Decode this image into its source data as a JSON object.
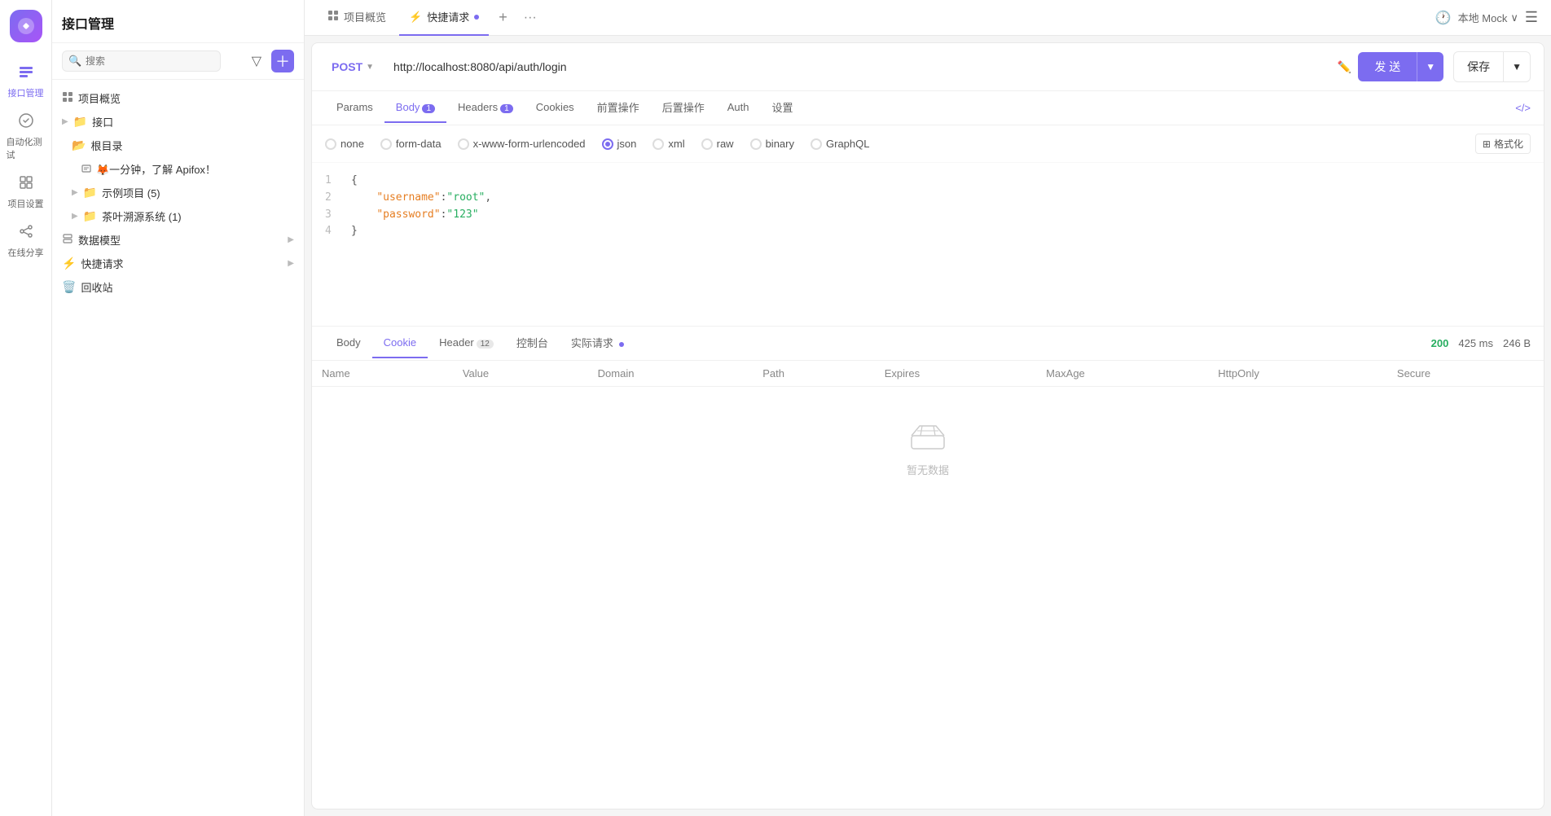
{
  "app": {
    "title": "接口管理"
  },
  "left_nav": {
    "items": [
      {
        "id": "api-mgmt",
        "label": "接口管理",
        "icon": "🔌",
        "active": true
      },
      {
        "id": "auto-test",
        "label": "自动化测试",
        "icon": "⚙️",
        "active": false
      },
      {
        "id": "project-settings",
        "label": "项目设置",
        "icon": "📋",
        "active": false
      },
      {
        "id": "online-share",
        "label": "在线分享",
        "icon": "🔗",
        "active": false
      }
    ]
  },
  "sidebar": {
    "title": "接口管理",
    "search_placeholder": "搜索",
    "tree": [
      {
        "id": "overview",
        "label": "项目概览",
        "icon": "📊",
        "indent": 0,
        "type": "item"
      },
      {
        "id": "api-group",
        "label": "接口",
        "icon": "📁",
        "indent": 0,
        "type": "group",
        "hasArrow": true
      },
      {
        "id": "root-dir",
        "label": "根目录",
        "icon": "📁",
        "indent": 1,
        "type": "folder"
      },
      {
        "id": "fox-intro",
        "label": "🦊一分钟，了解 Apifox！",
        "indent": 2,
        "type": "api"
      },
      {
        "id": "sample-proj",
        "label": "示例项目 (5)",
        "indent": 1,
        "type": "folder",
        "hasArrow": true
      },
      {
        "id": "tea-proj",
        "label": "茶叶溯源系统 (1)",
        "indent": 1,
        "type": "folder",
        "hasArrow": true
      },
      {
        "id": "data-model",
        "label": "数据模型",
        "icon": "📦",
        "indent": 0,
        "type": "group",
        "hasArrow": true
      },
      {
        "id": "quick-req",
        "label": "快捷请求",
        "icon": "⚡",
        "indent": 0,
        "type": "group",
        "hasArrow": true
      },
      {
        "id": "recycle",
        "label": "回收站",
        "icon": "🗑️",
        "indent": 0,
        "type": "item"
      }
    ]
  },
  "tabs": {
    "items": [
      {
        "id": "overview-tab",
        "label": "项目概览",
        "icon": "📊",
        "active": false
      },
      {
        "id": "quick-req-tab",
        "label": "快捷请求",
        "icon": "⚡",
        "active": true,
        "hasDot": true
      }
    ],
    "add_label": "+",
    "more_label": "···"
  },
  "top_right": {
    "mock_label": "本地 Mock",
    "clock_icon": "🕐"
  },
  "request": {
    "method": "POST",
    "url": "http://localhost:8080/api/auth/login",
    "send_label": "发 送",
    "save_label": "保存",
    "tabs": [
      {
        "id": "params",
        "label": "Params",
        "active": false
      },
      {
        "id": "body",
        "label": "Body",
        "active": true,
        "badge": "1"
      },
      {
        "id": "headers",
        "label": "Headers",
        "active": false,
        "badge": "1"
      },
      {
        "id": "cookies",
        "label": "Cookies",
        "active": false
      },
      {
        "id": "pre-script",
        "label": "前置操作",
        "active": false
      },
      {
        "id": "post-script",
        "label": "后置操作",
        "active": false
      },
      {
        "id": "auth",
        "label": "Auth",
        "active": false
      },
      {
        "id": "settings",
        "label": "设置",
        "active": false
      }
    ],
    "body_types": [
      {
        "id": "none",
        "label": "none",
        "checked": false
      },
      {
        "id": "form-data",
        "label": "form-data",
        "checked": false
      },
      {
        "id": "x-www-form-urlencoded",
        "label": "x-www-form-urlencoded",
        "checked": false
      },
      {
        "id": "json",
        "label": "json",
        "checked": true
      },
      {
        "id": "xml",
        "label": "xml",
        "checked": false
      },
      {
        "id": "raw",
        "label": "raw",
        "checked": false
      },
      {
        "id": "binary",
        "label": "binary",
        "checked": false
      },
      {
        "id": "graphql",
        "label": "GraphQL",
        "checked": false
      }
    ],
    "format_btn": "格式化",
    "code_lines": [
      {
        "num": "1",
        "content": "{"
      },
      {
        "num": "2",
        "content": "    \"username\":\"root\","
      },
      {
        "num": "3",
        "content": "    \"password\":\"123\""
      },
      {
        "num": "4",
        "content": "}"
      }
    ]
  },
  "response": {
    "tabs": [
      {
        "id": "body",
        "label": "Body",
        "active": false
      },
      {
        "id": "cookie",
        "label": "Cookie",
        "active": true
      },
      {
        "id": "header",
        "label": "Header",
        "active": false,
        "badge": "12"
      },
      {
        "id": "console",
        "label": "控制台",
        "active": false
      },
      {
        "id": "actual-req",
        "label": "实际请求",
        "active": false,
        "hasDot": true
      }
    ],
    "status": "200",
    "time": "425 ms",
    "size": "246 B",
    "cookie_cols": [
      "Name",
      "Value",
      "Domain",
      "Path",
      "Expires",
      "MaxAge",
      "HttpOnly",
      "Secure"
    ],
    "empty_text": "暂无数据"
  }
}
